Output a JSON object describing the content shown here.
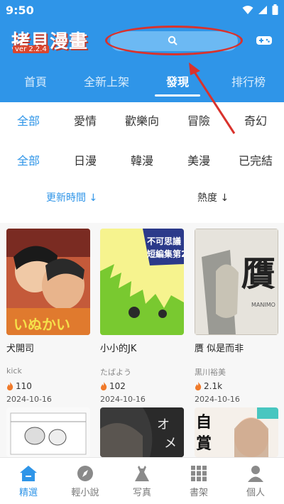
{
  "status": {
    "time": "9:50"
  },
  "header": {
    "brand": "拷貝漫畫",
    "version": "ver 2.2.4",
    "tabs": [
      {
        "label": "首頁"
      },
      {
        "label": "全新上架"
      },
      {
        "label": "發現"
      },
      {
        "label": "排行榜"
      }
    ]
  },
  "filters": {
    "genre": [
      {
        "label": "全部"
      },
      {
        "label": "愛情"
      },
      {
        "label": "歡樂向"
      },
      {
        "label": "冒險"
      },
      {
        "label": "奇幻"
      }
    ],
    "region": [
      {
        "label": "全部"
      },
      {
        "label": "日漫"
      },
      {
        "label": "韓漫"
      },
      {
        "label": "美漫"
      },
      {
        "label": "已完結"
      }
    ],
    "sort": {
      "updated": "更新時間",
      "popularity": "熱度"
    }
  },
  "comics": [
    {
      "title": "犬開司",
      "author": "kick",
      "popularity": "110",
      "date": "2024-10-16"
    },
    {
      "title": "小小的JK",
      "author": "たばよう",
      "popularity": "102",
      "date": "2024-10-16"
    },
    {
      "title": "贋 似是而非",
      "author": "黒川裕美",
      "popularity": "2.1k",
      "date": "2024-10-16"
    }
  ],
  "bottom_nav": [
    {
      "label": "精選",
      "icon": "home-icon"
    },
    {
      "label": "輕小說",
      "icon": "compass-icon"
    },
    {
      "label": "写真",
      "icon": "dress-icon"
    },
    {
      "label": "書架",
      "icon": "bookshelf-icon"
    },
    {
      "label": "個人",
      "icon": "person-icon"
    }
  ],
  "colors": {
    "accent": "#2f95e8",
    "annotation": "#d9322c",
    "flame": "#f07a2a"
  }
}
